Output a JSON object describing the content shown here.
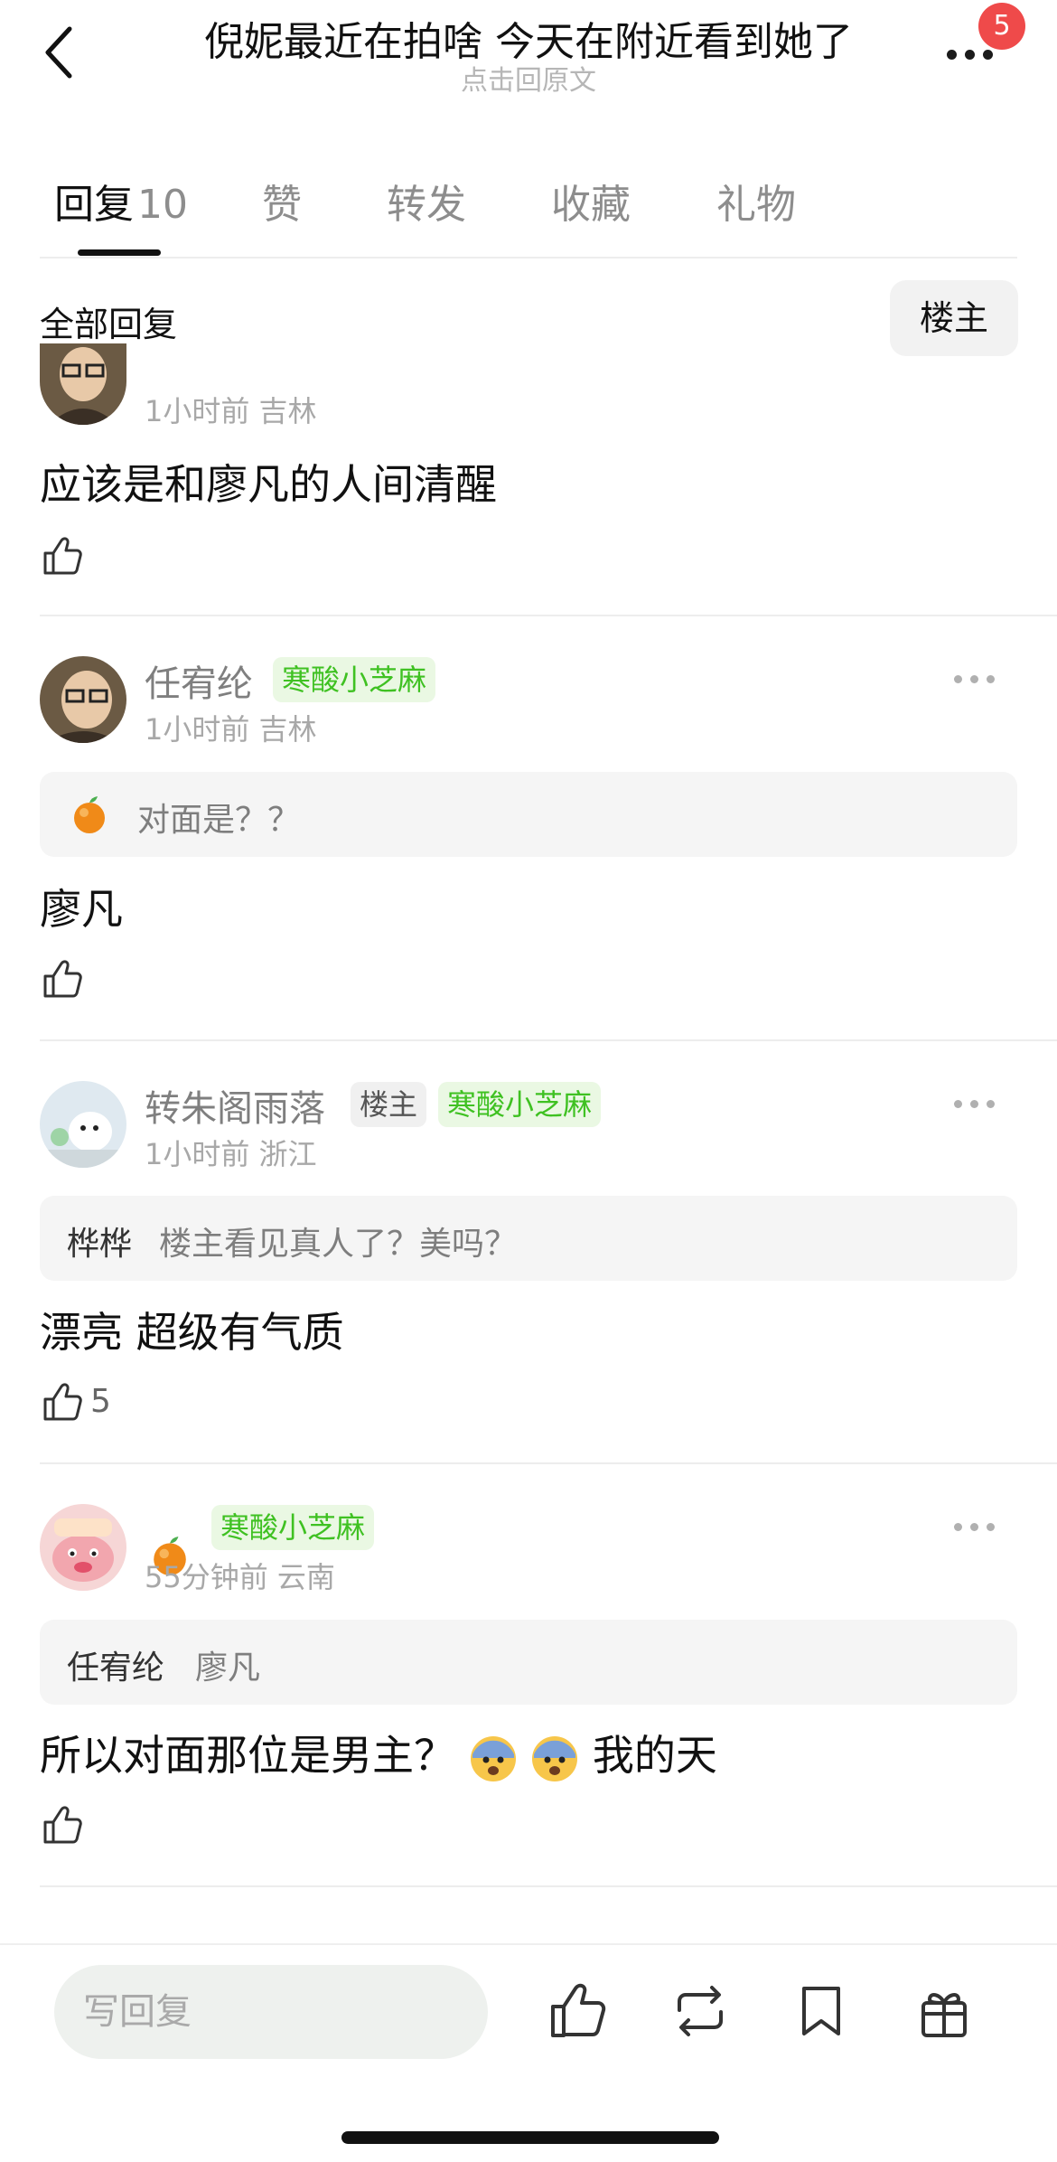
{
  "header": {
    "title": "倪妮最近在拍啥 今天在附近看到她了",
    "subtitle": "点击回原文",
    "notification_badge": "5"
  },
  "tabs": [
    {
      "label": "回复",
      "count": "10"
    },
    {
      "label": "赞"
    },
    {
      "label": "转发"
    },
    {
      "label": "收藏"
    },
    {
      "label": "礼物"
    }
  ],
  "section": {
    "title": "全部回复",
    "filter_button": "楼主"
  },
  "comments": [
    {
      "meta": "1小时前 吉林",
      "content": "应该是和廖凡的人间清醒"
    },
    {
      "username": "任宥纶",
      "badge": "寒酸小芝麻",
      "meta": "1小时前 吉林",
      "quote_author_icon": "orange-emoji",
      "quote_text": "对面是？？",
      "content": "廖凡"
    },
    {
      "username": "转朱阁雨落",
      "host_tag": "楼主",
      "badge": "寒酸小芝麻",
      "meta": "1小时前 浙江",
      "quote_author": "桦桦",
      "quote_text": "楼主看见真人了？美吗？",
      "content": "漂亮 超级有气质",
      "likes": "5"
    },
    {
      "username_icon": "orange-emoji",
      "badge": "寒酸小芝麻",
      "meta": "55分钟前 云南",
      "quote_author": "任宥纶",
      "quote_text": "廖凡",
      "content": "所以对面那位是男主？",
      "content_suffix": "我的天"
    }
  ],
  "bottom_bar": {
    "reply_placeholder": "写回复",
    "icons": [
      "like-icon",
      "repost-icon",
      "bookmark-icon",
      "gift-icon"
    ]
  },
  "colors": {
    "badge_green": "#3fc122",
    "badge_green_bg": "#eaf8e3",
    "notification_red": "#ef4a4a"
  }
}
